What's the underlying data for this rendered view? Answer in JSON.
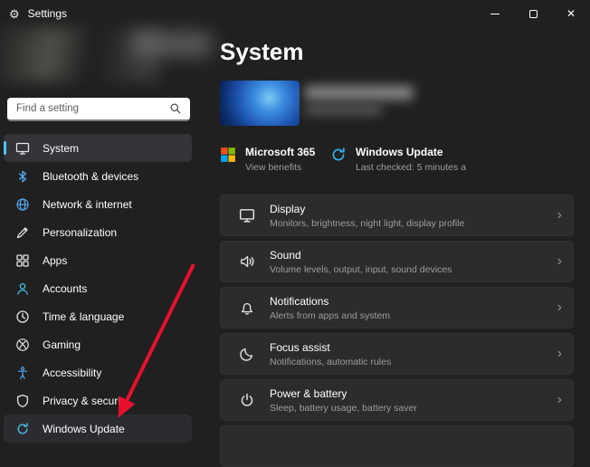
{
  "titlebar": {
    "title": "Settings"
  },
  "window_controls": {
    "close_glyph": "✕"
  },
  "sidebar": {
    "search": {
      "placeholder": "Find a setting"
    },
    "items": [
      {
        "label": "System",
        "selected": true
      },
      {
        "label": "Bluetooth & devices"
      },
      {
        "label": "Network & internet"
      },
      {
        "label": "Personalization"
      },
      {
        "label": "Apps"
      },
      {
        "label": "Accounts"
      },
      {
        "label": "Time & language"
      },
      {
        "label": "Gaming"
      },
      {
        "label": "Accessibility"
      },
      {
        "label": "Privacy & security"
      },
      {
        "label": "Windows Update",
        "highlighted": true
      }
    ]
  },
  "main": {
    "title": "System",
    "quick_actions": [
      {
        "title": "Microsoft 365",
        "subtitle": "View benefits"
      },
      {
        "title": "Windows Update",
        "subtitle": "Last checked: 5 minutes a"
      }
    ],
    "settings_rows": [
      {
        "title": "Display",
        "subtitle": "Monitors, brightness, night light, display profile"
      },
      {
        "title": "Sound",
        "subtitle": "Volume levels, output, input, sound devices"
      },
      {
        "title": "Notifications",
        "subtitle": "Alerts from apps and system"
      },
      {
        "title": "Focus assist",
        "subtitle": "Notifications, automatic rules"
      },
      {
        "title": "Power & battery",
        "subtitle": "Sleep, battery usage, battery saver"
      }
    ]
  },
  "icons": {
    "gear": "⚙",
    "chevron_right": "›"
  },
  "colors": {
    "accent": "#4cc2ff",
    "annotation_arrow": "#e8112d",
    "window_bg": "#202020",
    "card_bg": "#2c2c2c"
  }
}
